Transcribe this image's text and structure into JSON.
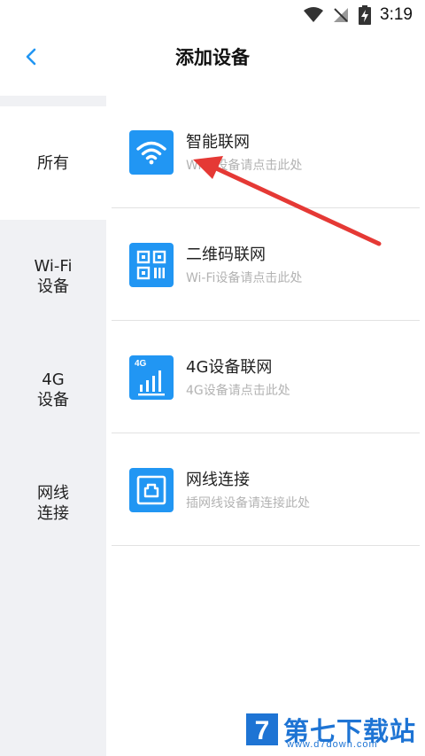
{
  "status_bar": {
    "time": "3:19",
    "icons": [
      "wifi-icon",
      "no-signal-icon",
      "battery-charging-icon"
    ]
  },
  "header": {
    "title": "添加设备",
    "back_icon": "chevron-left-icon"
  },
  "sidebar": {
    "items": [
      {
        "line1": "所有",
        "line2": "",
        "active": true
      },
      {
        "line1": "Wi-Fi",
        "line2": "设备",
        "active": false
      },
      {
        "line1": "4G",
        "line2": "设备",
        "active": false
      },
      {
        "line1": "网线",
        "line2": "连接",
        "active": false
      }
    ]
  },
  "options": [
    {
      "title": "智能联网",
      "subtitle": "Wi-Fi设备请点击此处",
      "icon": "wifi-icon"
    },
    {
      "title": "二维码联网",
      "subtitle": "Wi-Fi设备请点击此处",
      "icon": "qr-code-icon"
    },
    {
      "title": "4G设备联网",
      "subtitle": "4G设备请点击此处",
      "icon": "signal-bars-icon",
      "icon_text": "4G"
    },
    {
      "title": "网线连接",
      "subtitle": "插网线设备请连接此处",
      "icon": "ethernet-port-icon"
    }
  ],
  "watermark": {
    "name": "第七下载站",
    "url": "www.d7down.com",
    "logo_letter": "7"
  },
  "colors": {
    "accent": "#2196f3",
    "arrow": "#e53935",
    "sidebar_bg": "#f0f1f4",
    "watermark": "#1e74d4"
  }
}
